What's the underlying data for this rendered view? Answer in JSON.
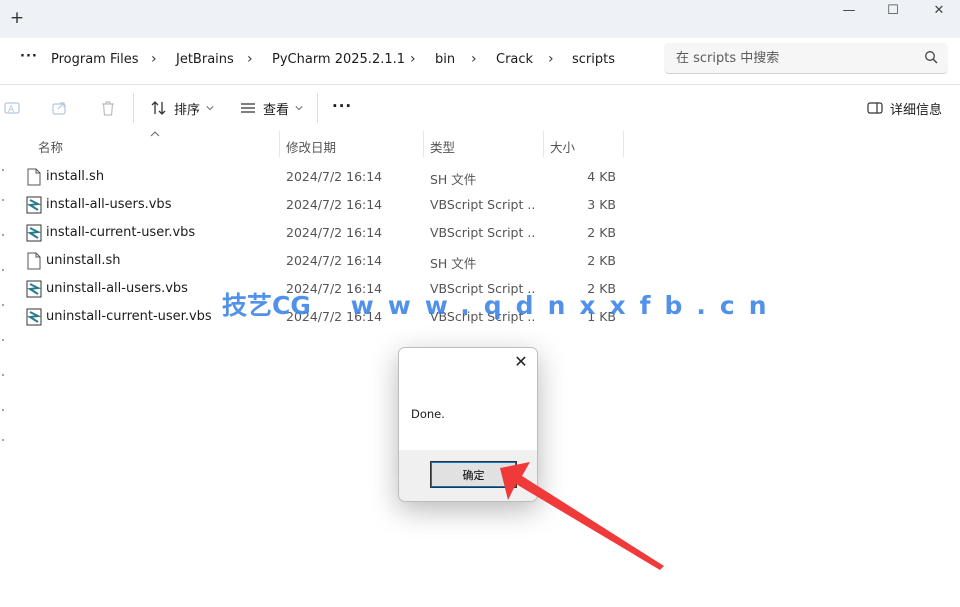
{
  "titlebar": {
    "new_tab": "+",
    "minimize": "—",
    "maximize": "☐",
    "close": "✕"
  },
  "addressbar": {
    "more": "···",
    "breadcrumbs": [
      "Program Files",
      "JetBrains",
      "PyCharm 2025.2.1.1",
      "bin",
      "Crack",
      "scripts"
    ],
    "separator": "›",
    "search_placeholder": "在 scripts 中搜索"
  },
  "toolbar": {
    "sort_label": "排序",
    "view_label": "查看",
    "more_label": "···",
    "details_label": "详细信息"
  },
  "columns": {
    "name": "名称",
    "modified": "修改日期",
    "type": "类型",
    "size": "大小"
  },
  "files": [
    {
      "name": "install.sh",
      "modified": "2024/7/2 16:14",
      "type": "SH 文件",
      "size": "4 KB",
      "icon": "generic-file-icon"
    },
    {
      "name": "install-all-users.vbs",
      "modified": "2024/7/2 16:14",
      "type": "VBScript Script ...",
      "size": "3 KB",
      "icon": "vbscript-file-icon"
    },
    {
      "name": "install-current-user.vbs",
      "modified": "2024/7/2 16:14",
      "type": "VBScript Script ...",
      "size": "2 KB",
      "icon": "vbscript-file-icon"
    },
    {
      "name": "uninstall.sh",
      "modified": "2024/7/2 16:14",
      "type": "SH 文件",
      "size": "2 KB",
      "icon": "generic-file-icon"
    },
    {
      "name": "uninstall-all-users.vbs",
      "modified": "2024/7/2 16:14",
      "type": "VBScript Script ...",
      "size": "2 KB",
      "icon": "vbscript-file-icon"
    },
    {
      "name": "uninstall-current-user.vbs",
      "modified": "2024/7/2 16:14",
      "type": "VBScript Script ...",
      "size": "1 KB",
      "icon": "vbscript-file-icon"
    }
  ],
  "watermark": {
    "cn": "技艺CG",
    "url": "www.qdnxxfb.cn"
  },
  "dialog": {
    "message": "Done.",
    "ok_label": "确定",
    "close": "✕"
  },
  "colors": {
    "titlebar_bg": "#eef1f6",
    "watermark": "#3f86e8",
    "arrow": "#f03a3a",
    "focus": "#0078d4"
  }
}
